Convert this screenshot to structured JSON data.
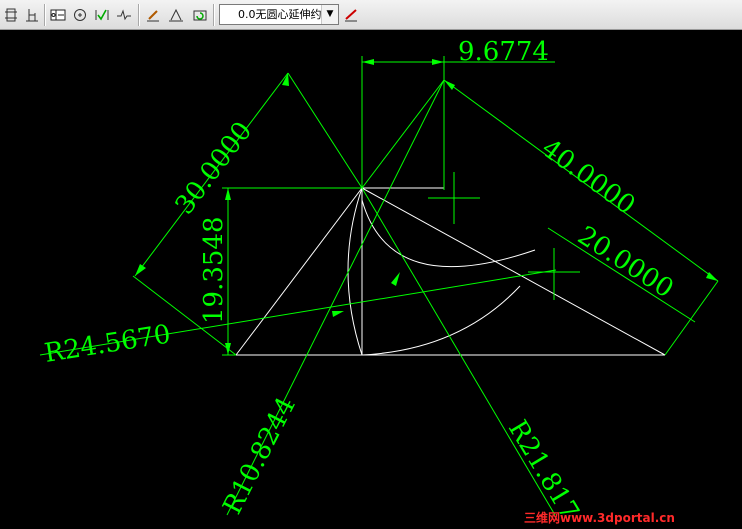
{
  "toolbar": {
    "buttons": [
      {
        "name": "dim-ordinate-icon"
      },
      {
        "name": "dim-baseline-icon"
      },
      {
        "name": "tolerance-icon"
      },
      {
        "name": "center-mark-icon"
      },
      {
        "name": "dim-inspect-icon"
      },
      {
        "name": "dim-jogged-linear-icon"
      },
      {
        "name": "dim-edit-icon"
      },
      {
        "name": "dim-text-edit-icon"
      },
      {
        "name": "dim-update-icon"
      },
      {
        "name": "dim-style-icon"
      }
    ],
    "dimstyle_value": "0.0无圆心延伸约"
  },
  "colors": {
    "background": "#000000",
    "geometry": "#ffffff",
    "dimension": "#00ff00",
    "watermark": "#ff2a2a"
  },
  "dimensions": {
    "d1": "9.6774",
    "d2": "30.0000",
    "d3": "40.0000",
    "d4": "20.0000",
    "d5": "19.3548",
    "d6": "R24.5670",
    "d7": "R10.8244",
    "d8": "R21.817"
  },
  "watermark": "三维网www.3dportal.cn"
}
